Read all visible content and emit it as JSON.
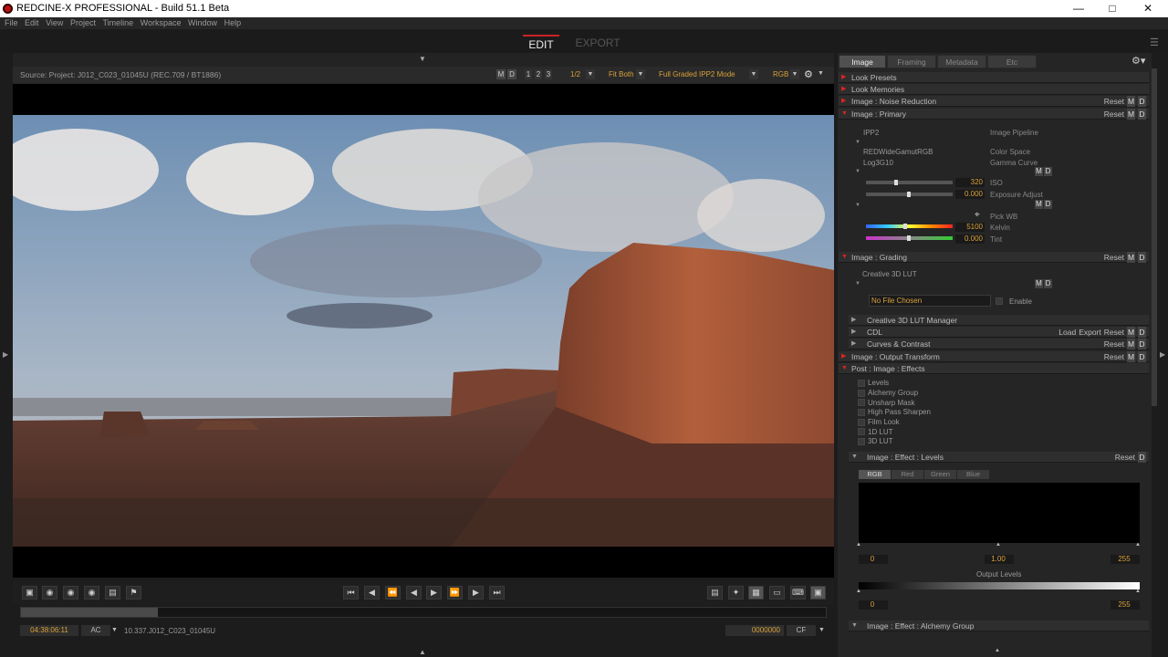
{
  "window": {
    "title": "REDCINE-X PROFESSIONAL - Build 51.1 Beta"
  },
  "menu": [
    "File",
    "Edit",
    "View",
    "Project",
    "Timeline",
    "Workspace",
    "Window",
    "Help"
  ],
  "modes": {
    "edit": "EDIT",
    "export": "EXPORT"
  },
  "viewer": {
    "source": "Source: Project: J012_C023_01045U     (REC.709 / BT1886)",
    "m": "M",
    "d": "D",
    "p1": "1",
    "p2": "2",
    "p3": "3",
    "resolution": "1/2",
    "fit": "Fit Both",
    "mode": "Full Graded IPP2 Mode",
    "channel": "RGB"
  },
  "timeline": {
    "timecode": "04:38:06:11",
    "ac": "AC",
    "clip": "10.337.J012_C023_01045U",
    "frame": "0000000",
    "cf": "CF",
    "progress": 0.17
  },
  "panel": {
    "tabs": [
      "Image",
      "Framing",
      "Metadata",
      "Etc"
    ],
    "sections": {
      "look_presets": "Look Presets",
      "look_memories": "Look Memories",
      "noise": "Image : Noise Reduction",
      "primary": "Image : Primary",
      "grading": "Image : Grading",
      "lut_mgr": "Creative 3D LUT Manager",
      "cdl": "CDL",
      "curves": "Curves & Contrast",
      "output": "Image : Output Transform",
      "effects": "Post : Image : Effects",
      "levels": "Image : Effect : Levels",
      "alchemy": "Image : Effect : Alchemy Group"
    },
    "buttons": {
      "reset": "Reset",
      "load": "Load",
      "export": "Export",
      "m": "M",
      "d": "D"
    },
    "primary": {
      "ipp2": "IPP2",
      "pipeline": "Image Pipeline",
      "colorspace_val": "REDWideGamutRGB",
      "colorspace": "Color Space",
      "gamma_val": "Log3G10",
      "gamma": "Gamma Curve",
      "iso_val": "320",
      "iso": "ISO",
      "exp_val": "0.000",
      "exp": "Exposure Adjust",
      "pickwb": "Pick WB",
      "kelvin_val": "5100",
      "kelvin": "Kelvin",
      "tint_val": "0.000",
      "tint": "Tint"
    },
    "grading": {
      "lut_label": "Creative 3D LUT",
      "nofile": "No File Chosen",
      "enable": "Enable"
    },
    "effects": [
      "Levels",
      "Alchemy Group",
      "Unsharp Mask",
      "High Pass Sharpen",
      "Film Look",
      "1D LUT",
      "3D LUT"
    ],
    "levels": {
      "tabs": [
        "RGB",
        "Red",
        "Green",
        "Blue"
      ],
      "in_low": "0",
      "gamma": "1.00",
      "in_high": "255",
      "output_label": "Output Levels",
      "out_low": "0",
      "out_high": "255"
    }
  }
}
